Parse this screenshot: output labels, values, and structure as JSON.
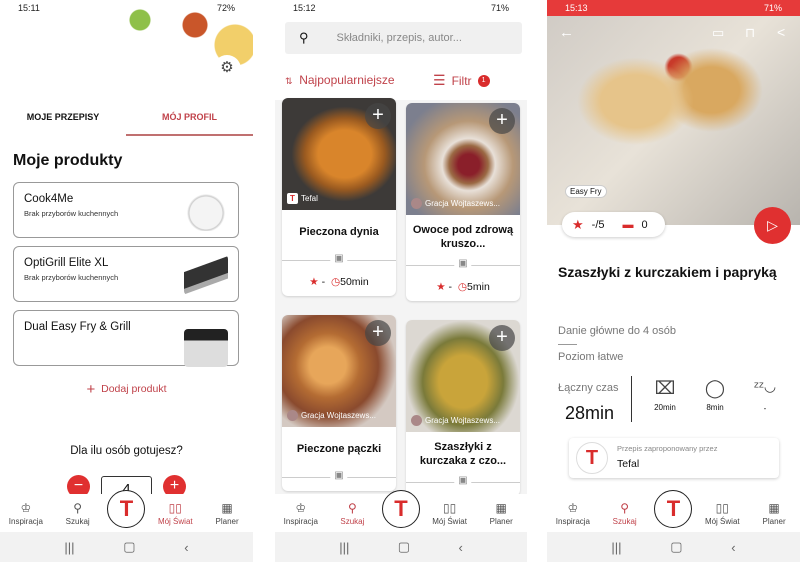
{
  "screen1": {
    "status_time": "15:11",
    "status_battery": "72%",
    "tabs": [
      {
        "label": "MOJE PRZEPISY"
      },
      {
        "label": "MÓJ PROFIL",
        "active": true
      }
    ],
    "section_title": "Moje produkty",
    "products": [
      {
        "name": "Cook4Me",
        "subtitle": "Brak przyborów kuchennych"
      },
      {
        "name": "OptiGrill Elite XL",
        "subtitle": "Brak przyborów kuchennych"
      },
      {
        "name": "Dual Easy Fry & Grill",
        "subtitle": ""
      }
    ],
    "add_product": "Dodaj produkt",
    "servings_question": "Dla ilu osób gotujesz?",
    "servings_value": "4",
    "active_nav": "Mój Świat"
  },
  "screen2": {
    "status_time": "15:12",
    "status_battery": "71%",
    "search_placeholder": "Składniki, przepis, autor...",
    "sort_label": "Najpopularniejsze",
    "filter_label": "Filtr",
    "filter_count": "1",
    "recipes": [
      {
        "title": "Pieczona dynia",
        "author": "Tefal",
        "rating": "-",
        "time": "50min"
      },
      {
        "title": "Owoce pod zdrową kruszo...",
        "author": "Gracja Wojtaszews...",
        "rating": "-",
        "time": "5min"
      },
      {
        "title": "Pieczone pączki",
        "author": "Gracja Wojtaszews..."
      },
      {
        "title": "Szaszłyki z kurczaka z czo...",
        "author": "Gracja Wojtaszews..."
      }
    ],
    "active_nav": "Szukaj"
  },
  "screen3": {
    "status_time": "15:13",
    "status_battery": "71%",
    "badge": "Easy Fry",
    "rating": "-/5",
    "comments": "0",
    "title": "Szaszłyki z kurczakiem i papryką",
    "category": "Danie główne do 4 osób",
    "level": "Poziom łatwe",
    "total_label": "Łączny czas",
    "total_time": "28min",
    "prep_time": "20min",
    "cook_time": "8min",
    "rest_time": "-",
    "suggested_by_label": "Przepis zaproponowany przez",
    "suggested_by": "Tefal"
  },
  "nav": {
    "items": [
      "Inspiracja",
      "Szukaj",
      "Mój Świat",
      "Planer"
    ]
  },
  "colors": {
    "accent": "#d92c2c",
    "active_tab": "#c0424a"
  }
}
